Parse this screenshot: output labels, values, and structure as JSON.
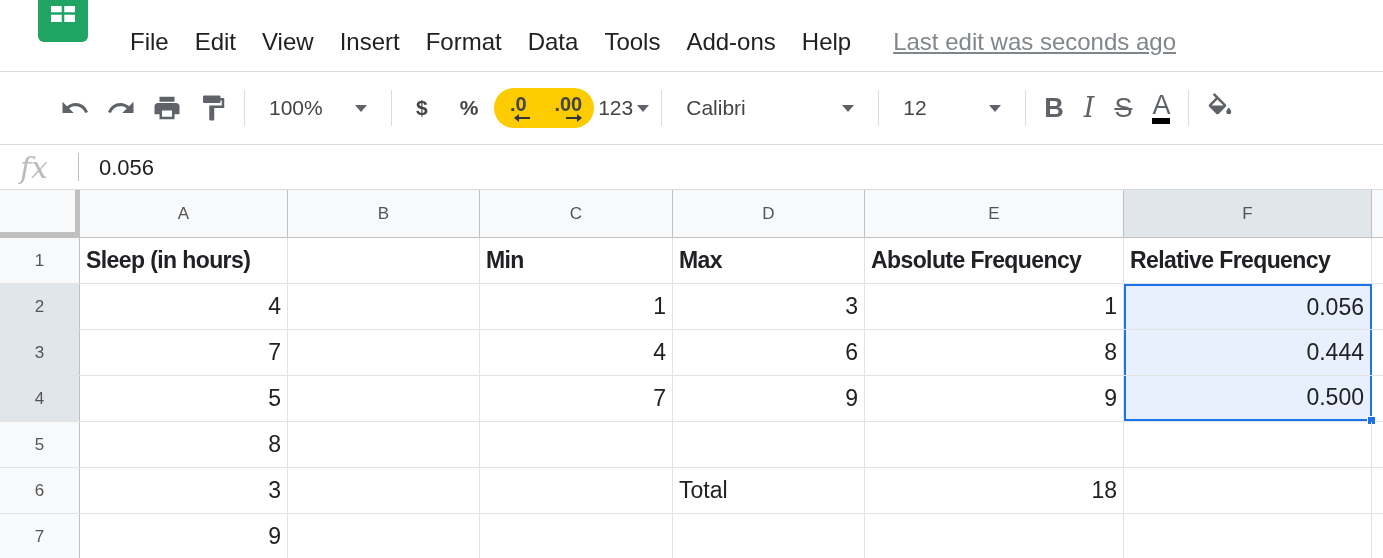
{
  "menu": [
    {
      "label": "File"
    },
    {
      "label": "Edit"
    },
    {
      "label": "View"
    },
    {
      "label": "Insert"
    },
    {
      "label": "Format"
    },
    {
      "label": "Data"
    },
    {
      "label": "Tools"
    },
    {
      "label": "Add-ons"
    },
    {
      "label": "Help"
    }
  ],
  "last_edit": "Last edit was seconds ago",
  "toolbar": [
    {
      "kind": "undo"
    },
    {
      "kind": "redo"
    },
    {
      "kind": "print"
    },
    {
      "kind": "paint-format"
    },
    {
      "kind": "divider"
    },
    {
      "kind": "dropdown",
      "label": "100%"
    },
    {
      "kind": "divider"
    },
    {
      "kind": "text",
      "label": "$",
      "highlighted": false
    },
    {
      "kind": "text",
      "label": "%",
      "highlighted": false
    },
    {
      "kind": "decrease-decimal",
      "label": ".0",
      "highlighted": true
    },
    {
      "kind": "increase-decimal",
      "label": ".00",
      "highlighted": true
    },
    {
      "kind": "small-dropdown",
      "label": "123"
    },
    {
      "kind": "divider"
    },
    {
      "kind": "font-dropdown",
      "label": "Calibri"
    },
    {
      "kind": "divider"
    },
    {
      "kind": "dropdown",
      "label": "12"
    },
    {
      "kind": "divider"
    },
    {
      "kind": "bold",
      "label": "B"
    },
    {
      "kind": "italic",
      "label": "I"
    },
    {
      "kind": "strike",
      "label": "S"
    },
    {
      "kind": "text-color",
      "label": "A"
    },
    {
      "kind": "divider"
    },
    {
      "kind": "fill"
    }
  ],
  "formula_bar": {
    "label": "fx",
    "value": "0.056"
  },
  "columns": [
    {
      "label": "A",
      "selected": false
    },
    {
      "label": "B",
      "selected": false
    },
    {
      "label": "C",
      "selected": false
    },
    {
      "label": "D",
      "selected": false
    },
    {
      "label": "E",
      "selected": false
    },
    {
      "label": "F",
      "selected": true
    }
  ],
  "rows": [
    {
      "header": "1",
      "selected": false,
      "bold": true,
      "cells": [
        {
          "text": "Sleep (in hours)",
          "kind": "text",
          "selected": false
        },
        {
          "selected": false
        },
        {
          "text": "Min",
          "kind": "text",
          "selected": false
        },
        {
          "text": "Max",
          "kind": "text",
          "selected": false
        },
        {
          "text": "Absolute Frequency",
          "kind": "text",
          "selected": false
        },
        {
          "text": "Relative Frequency",
          "kind": "text",
          "selected": false
        }
      ]
    },
    {
      "header": "2",
      "selected": true,
      "bold": false,
      "cells": [
        {
          "text": "4",
          "kind": "number",
          "selected": false
        },
        {
          "selected": false
        },
        {
          "text": "1",
          "kind": "number",
          "selected": false
        },
        {
          "text": "3",
          "kind": "number",
          "selected": false
        },
        {
          "text": "1",
          "kind": "number",
          "selected": false
        },
        {
          "text": "0.056",
          "kind": "number",
          "selected": true
        }
      ]
    },
    {
      "header": "3",
      "selected": true,
      "bold": false,
      "cells": [
        {
          "text": "7",
          "kind": "number",
          "selected": false
        },
        {
          "selected": false
        },
        {
          "text": "4",
          "kind": "number",
          "selected": false
        },
        {
          "text": "6",
          "kind": "number",
          "selected": false
        },
        {
          "text": "8",
          "kind": "number",
          "selected": false
        },
        {
          "text": "0.444",
          "kind": "number",
          "selected": true
        }
      ]
    },
    {
      "header": "4",
      "selected": true,
      "bold": false,
      "cells": [
        {
          "text": "5",
          "kind": "number",
          "selected": false
        },
        {
          "selected": false
        },
        {
          "text": "7",
          "kind": "number",
          "selected": false
        },
        {
          "text": "9",
          "kind": "number",
          "selected": false
        },
        {
          "text": "9",
          "kind": "number",
          "selected": false
        },
        {
          "text": "0.500",
          "kind": "number",
          "selected": true
        }
      ]
    },
    {
      "header": "5",
      "selected": false,
      "bold": false,
      "cells": [
        {
          "text": "8",
          "kind": "number",
          "selected": false
        },
        {
          "selected": false
        },
        {
          "selected": false
        },
        {
          "selected": false
        },
        {
          "selected": false
        },
        {
          "selected": false
        }
      ]
    },
    {
      "header": "6",
      "selected": false,
      "bold": false,
      "cells": [
        {
          "text": "3",
          "kind": "number",
          "selected": false
        },
        {
          "selected": false
        },
        {
          "selected": false
        },
        {
          "text": "Total",
          "kind": "text",
          "selected": false
        },
        {
          "text": "18",
          "kind": "number",
          "selected": false
        },
        {
          "selected": false
        }
      ]
    },
    {
      "header": "7",
      "selected": false,
      "bold": false,
      "cells": [
        {
          "text": "9",
          "kind": "number",
          "selected": false
        },
        {
          "selected": false
        },
        {
          "selected": false
        },
        {
          "selected": false
        },
        {
          "selected": false
        },
        {
          "selected": false
        }
      ]
    }
  ]
}
